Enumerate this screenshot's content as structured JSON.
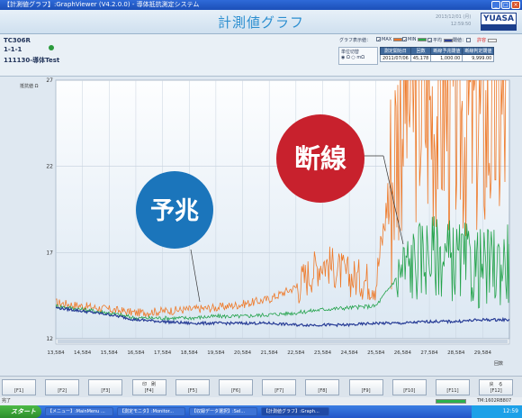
{
  "window": {
    "title": "【計測値グラフ】:GraphViewer (V4.2.0.0) - 導体抵抗測定システム"
  },
  "header": {
    "title": "計測値グラフ",
    "date": "2013/12/01 (月)",
    "time": "12:59:50",
    "logo": "YUASA"
  },
  "info": {
    "device": "TC306R",
    "position": "1-1-1",
    "test_name": "111130-導体Test",
    "status_color": "#2a9a3c"
  },
  "graph_options": {
    "label": "グラフ表示値：",
    "items": [
      {
        "label": "MAX",
        "checked": true,
        "color": "#e8742a"
      },
      {
        "label": "MIN",
        "checked": true,
        "color": "#2aa845"
      },
      {
        "label": "平均",
        "checked": true,
        "color": "#2b3f9a"
      },
      {
        "label": "閾値：",
        "checked": false,
        "color": ""
      },
      {
        "label": "許容",
        "checked": false,
        "color": "#e02020"
      }
    ]
  },
  "unit_select": {
    "label": "単位切替",
    "options": [
      "Ω",
      "mΩ"
    ],
    "selected": "Ω"
  },
  "summary_table": {
    "headers": [
      "測定開始日",
      "回数",
      "断線予兆閾値",
      "断線判定閾値"
    ],
    "values": [
      "2011/07/06",
      "45,178",
      "1,000.00",
      "9,999.00"
    ]
  },
  "chart_data": {
    "type": "line",
    "ylabel": "抵抗値 Ω",
    "xlabel": "回数",
    "ylim": [
      12,
      27
    ],
    "yticks": [
      "27",
      "22",
      "17",
      "12"
    ],
    "xlim": [
      13584,
      30584
    ],
    "xticks": [
      "13,584",
      "14,584",
      "15,584",
      "16,584",
      "17,584",
      "18,584",
      "19,584",
      "20,584",
      "21,584",
      "22,584",
      "23,584",
      "24,584",
      "25,584",
      "26,584",
      "27,584",
      "28,584",
      "29,584"
    ],
    "series": [
      {
        "name": "MAX",
        "color": "#ee7a2a",
        "x": [
          13584,
          14584,
          15584,
          16584,
          17584,
          18584,
          19584,
          20584,
          21584,
          22584,
          23584,
          24584,
          25584,
          26584,
          27584,
          28584,
          29584,
          30584
        ],
        "values": [
          14.1,
          13.9,
          13.7,
          13.5,
          13.6,
          13.7,
          13.8,
          14.0,
          14.3,
          15.0,
          16.5,
          15.6,
          15.3,
          26.0,
          25.5,
          25.0,
          24.5,
          25.0
        ]
      },
      {
        "name": "MIN",
        "color": "#22a24a",
        "x": [
          13584,
          14584,
          15584,
          16584,
          17584,
          18584,
          19584,
          20584,
          21584,
          22584,
          23584,
          24584,
          25584,
          26584,
          27584,
          28584,
          29584,
          30584
        ],
        "values": [
          13.9,
          13.7,
          13.5,
          13.2,
          13.2,
          13.2,
          13.3,
          13.3,
          13.4,
          13.5,
          13.7,
          13.8,
          13.9,
          16.0,
          17.0,
          16.5,
          16.0,
          16.5
        ]
      },
      {
        "name": "平均",
        "color": "#273c96",
        "x": [
          13584,
          14584,
          15584,
          16584,
          17584,
          18584,
          19584,
          20584,
          21584,
          22584,
          23584,
          24584,
          25584,
          26584,
          27584,
          28584,
          29584,
          30584
        ],
        "values": [
          13.8,
          13.6,
          13.4,
          13.1,
          13.0,
          12.9,
          12.9,
          12.9,
          12.9,
          12.8,
          12.8,
          12.8,
          12.9,
          12.9,
          13.0,
          13.0,
          13.1,
          13.1
        ]
      }
    ],
    "annotations": [
      {
        "text": "予兆",
        "color": "#1b75bb"
      },
      {
        "text": "断線",
        "color": "#c8212d"
      }
    ]
  },
  "function_keys": [
    {
      "label": "[F1]",
      "title": ""
    },
    {
      "label": "[F2]",
      "title": ""
    },
    {
      "label": "[F3]",
      "title": ""
    },
    {
      "label": "[F4]",
      "title": "印　刷"
    },
    {
      "label": "[F5]",
      "title": ""
    },
    {
      "label": "[F6]",
      "title": ""
    },
    {
      "label": "[F7]",
      "title": ""
    },
    {
      "label": "[F8]",
      "title": ""
    },
    {
      "label": "[F9]",
      "title": ""
    },
    {
      "label": "[F10]",
      "title": ""
    },
    {
      "label": "[F11]",
      "title": ""
    },
    {
      "label": "[F12]",
      "title": "戻　る"
    }
  ],
  "statusbar": {
    "left": "完了",
    "right": "TM:1602RB807",
    "progress": 1.0
  },
  "taskbar": {
    "start": "スタート",
    "tasks": [
      "【メニュー】:MainMenu ...",
      "【測定モニタ】:Monitor...",
      "【収録データ選択】:Sel...",
      "【計測値グラフ】:Graph..."
    ],
    "active_index": 3,
    "clock": "12:59"
  }
}
